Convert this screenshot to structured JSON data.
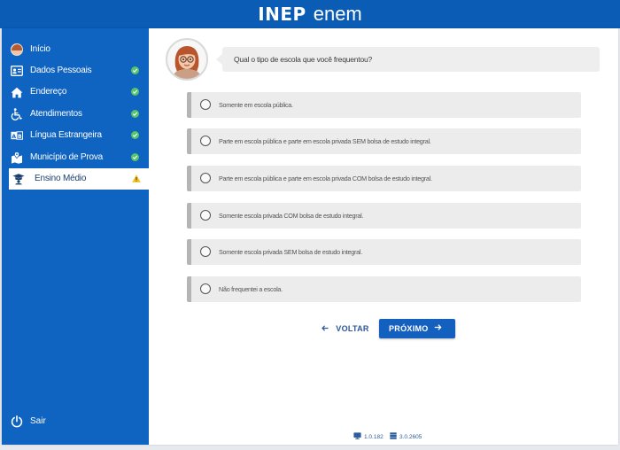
{
  "header": {
    "logo_inep": "INEP",
    "logo_enem": "enem"
  },
  "sidebar": {
    "items": [
      {
        "label": "Início",
        "icon": "avatar-icon",
        "status": "none"
      },
      {
        "label": "Dados Pessoais",
        "icon": "id-card-icon",
        "status": "complete"
      },
      {
        "label": "Endereço",
        "icon": "home-icon",
        "status": "complete"
      },
      {
        "label": "Atendimentos",
        "icon": "wheelchair-icon",
        "status": "complete"
      },
      {
        "label": "Língua Estrangeira",
        "icon": "language-icon",
        "status": "complete"
      },
      {
        "label": "Município de Prova",
        "icon": "map-icon",
        "status": "complete"
      },
      {
        "label": "Ensino Médio",
        "icon": "graduation-icon",
        "status": "warning"
      }
    ],
    "logout_label": "Sair"
  },
  "main": {
    "question": "Qual o tipo de escola que você frequentou?",
    "options": [
      "Somente em escola pública.",
      "Parte em escola pública e parte em escola privada SEM bolsa de estudo integral.",
      "Parte em escola pública e parte em escola privada COM bolsa de estudo integral.",
      "Somente escola privada COM bolsa de estudo integral.",
      "Somente escola privada SEM bolsa de estudo integral.",
      "Não frequentei a escola."
    ],
    "back_label": "VOLTAR",
    "next_label": "PRÓXIMO"
  },
  "footer": {
    "frontend_version": "1.0.182",
    "backend_version": "3.0.2605"
  },
  "colors": {
    "brand_blue": "#0f63c1",
    "check_green": "#55c46a",
    "warning_yellow": "#f1c21b"
  }
}
